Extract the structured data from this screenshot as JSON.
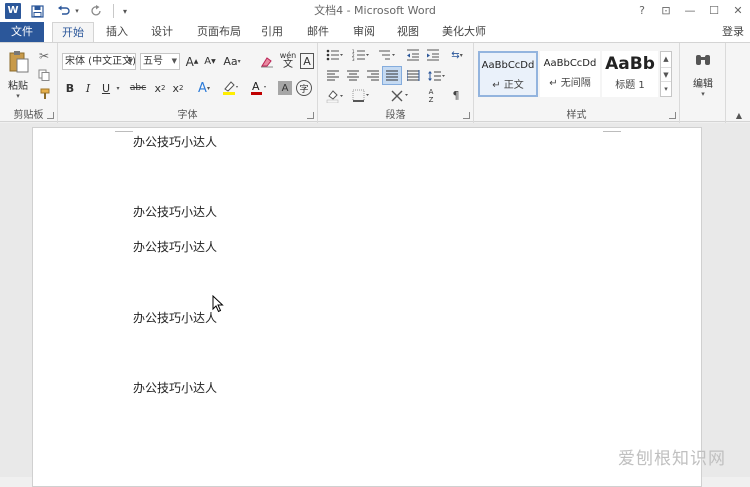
{
  "window": {
    "title": "文档4 - Microsoft Word",
    "app_icon_letter": "W",
    "help": "?",
    "ribbon_display": "⊡",
    "minimize": "—",
    "maximize": "☐",
    "close": "✕"
  },
  "tabs": {
    "file": "文件",
    "items": [
      "开始",
      "插入",
      "设计",
      "页面布局",
      "引用",
      "邮件",
      "审阅",
      "视图",
      "美化大师"
    ],
    "login": "登录"
  },
  "ribbon": {
    "clipboard": {
      "paste_label": "粘贴",
      "group_label": "剪贴板"
    },
    "font": {
      "font_name": "宋体 (中文正文)",
      "font_size": "五号",
      "wen_label": "wén",
      "wen_char": "文",
      "group_label": "字体"
    },
    "paragraph": {
      "group_label": "段落"
    },
    "styles": {
      "items": [
        {
          "sample": "AaBbCcDd",
          "name": "↵ 正文"
        },
        {
          "sample": "AaBbCcDd",
          "name": "↵ 无间隔"
        },
        {
          "sample": "AaBb",
          "name": "标题 1"
        }
      ],
      "group_label": "样式"
    },
    "editing": {
      "label": "编辑"
    }
  },
  "document": {
    "paragraphs": [
      "办公技巧小达人",
      "办公技巧小达人",
      "办公技巧小达人",
      "办公技巧小达人",
      "办公技巧小达人"
    ]
  },
  "watermark": "爱刨根知识网"
}
